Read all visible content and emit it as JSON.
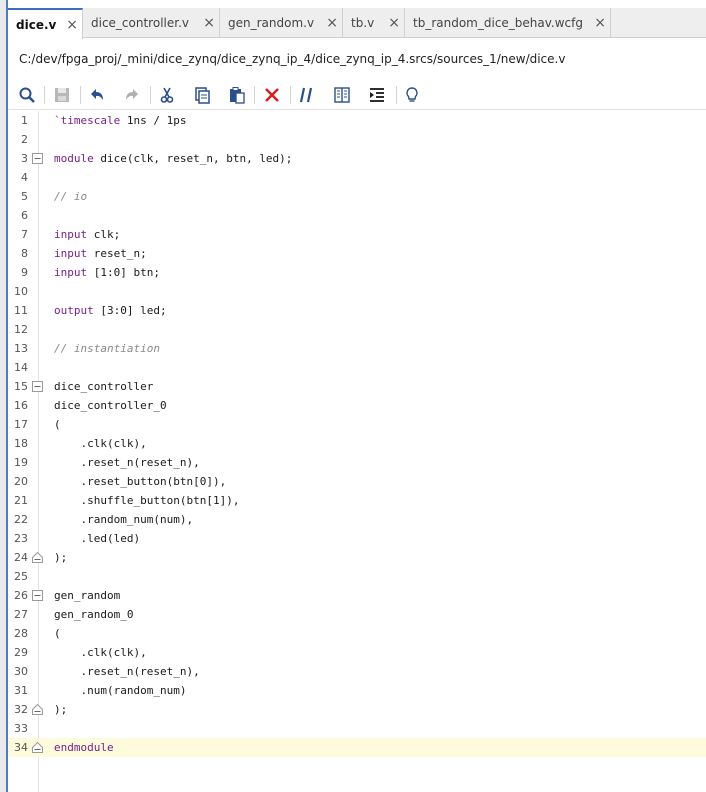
{
  "tabs": [
    {
      "label": "dice.v",
      "active": true
    },
    {
      "label": "dice_controller.v",
      "active": false
    },
    {
      "label": "gen_random.v",
      "active": false
    },
    {
      "label": "tb.v",
      "active": false
    },
    {
      "label": "tb_random_dice_behav.wcfg",
      "active": false
    }
  ],
  "close_glyph": "×",
  "file_path": "C:/dev/fpga_proj/_mini/dice_zynq/dice_zynq_ip_4/dice_zynq_ip_4.srcs/sources_1/new/dice.v",
  "toolbar_icons": [
    "search-icon",
    "save-icon",
    "undo-icon",
    "redo-icon",
    "cut-icon",
    "copy-icon",
    "paste-icon",
    "delete-icon",
    "comment-icon",
    "block-icon",
    "indent-icon",
    "lightbulb-icon"
  ],
  "colors": {
    "accent": "#3b6fc4",
    "keyword": "#7a1f8c",
    "comment": "#8a8a8a",
    "current_line": "#fdfbdc",
    "delete_red": "#d62020"
  },
  "current_line_number": "34",
  "lines": [
    {
      "n": "1",
      "pre": "",
      "kw": "`timescale",
      "rest": " 1ns / 1ps"
    },
    {
      "n": "2",
      "pre": "",
      "kw": "",
      "rest": ""
    },
    {
      "n": "3",
      "pre": "",
      "kw": "module",
      "rest": " dice(clk, reset_n, btn, led);",
      "fold": "open"
    },
    {
      "n": "4",
      "pre": "",
      "kw": "",
      "rest": ""
    },
    {
      "n": "5",
      "pre": "",
      "kw": "",
      "rest": "",
      "comment": "// io"
    },
    {
      "n": "6",
      "pre": "",
      "kw": "",
      "rest": ""
    },
    {
      "n": "7",
      "pre": "",
      "kw": "input",
      "rest": " clk;"
    },
    {
      "n": "8",
      "pre": "",
      "kw": "input",
      "rest": " reset_n;"
    },
    {
      "n": "9",
      "pre": "",
      "kw": "input",
      "rest": " [1:0] btn;"
    },
    {
      "n": "10",
      "pre": "",
      "kw": "",
      "rest": ""
    },
    {
      "n": "11",
      "pre": "",
      "kw": "output",
      "rest": " [3:0] led;"
    },
    {
      "n": "12",
      "pre": "",
      "kw": "",
      "rest": ""
    },
    {
      "n": "13",
      "pre": "",
      "kw": "",
      "rest": "",
      "comment": "// instantiation"
    },
    {
      "n": "14",
      "pre": "",
      "kw": "",
      "rest": ""
    },
    {
      "n": "15",
      "pre": "",
      "kw": "",
      "rest": "dice_controller",
      "fold": "open"
    },
    {
      "n": "16",
      "pre": "",
      "kw": "",
      "rest": "dice_controller_0"
    },
    {
      "n": "17",
      "pre": "",
      "kw": "",
      "rest": "("
    },
    {
      "n": "18",
      "pre": "    ",
      "kw": "",
      "rest": ".clk(clk),"
    },
    {
      "n": "19",
      "pre": "    ",
      "kw": "",
      "rest": ".reset_n(reset_n),"
    },
    {
      "n": "20",
      "pre": "    ",
      "kw": "",
      "rest": ".reset_button(btn[0]),"
    },
    {
      "n": "21",
      "pre": "    ",
      "kw": "",
      "rest": ".shuffle_button(btn[1]),"
    },
    {
      "n": "22",
      "pre": "    ",
      "kw": "",
      "rest": ".random_num(num),"
    },
    {
      "n": "23",
      "pre": "    ",
      "kw": "",
      "rest": ".led(led)"
    },
    {
      "n": "24",
      "pre": "",
      "kw": "",
      "rest": ");",
      "fold": "close"
    },
    {
      "n": "25",
      "pre": "",
      "kw": "",
      "rest": ""
    },
    {
      "n": "26",
      "pre": "",
      "kw": "",
      "rest": "gen_random",
      "fold": "open"
    },
    {
      "n": "27",
      "pre": "",
      "kw": "",
      "rest": "gen_random_0"
    },
    {
      "n": "28",
      "pre": "",
      "kw": "",
      "rest": "("
    },
    {
      "n": "29",
      "pre": "    ",
      "kw": "",
      "rest": ".clk(clk),"
    },
    {
      "n": "30",
      "pre": "    ",
      "kw": "",
      "rest": ".reset_n(reset_n),"
    },
    {
      "n": "31",
      "pre": "    ",
      "kw": "",
      "rest": ".num(random_num)"
    },
    {
      "n": "32",
      "pre": "",
      "kw": "",
      "rest": ");",
      "fold": "close"
    },
    {
      "n": "33",
      "pre": "",
      "kw": "",
      "rest": ""
    },
    {
      "n": "34",
      "pre": "",
      "kw": "endmodule",
      "rest": "",
      "fold": "close"
    }
  ]
}
